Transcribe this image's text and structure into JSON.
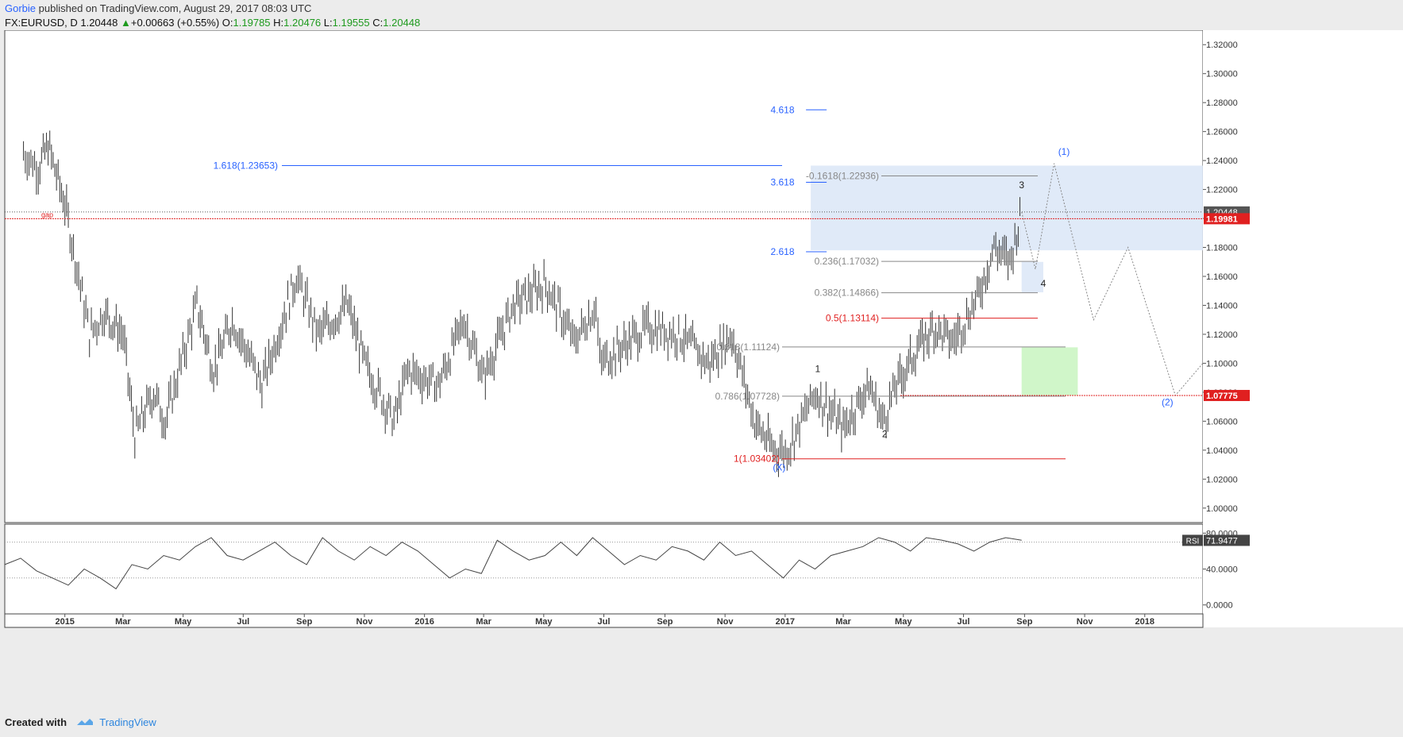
{
  "header": {
    "author": "Gorbie",
    "published": "published on TradingView.com, August 29, 2017 08:03 UTC",
    "symbol": "FX:EURUSD, D",
    "last": "1.20448",
    "change": "+0.00663 (+0.55%)",
    "o_label": "O:",
    "o": "1.19785",
    "h_label": "H:",
    "h": "1.20476",
    "l_label": "L:",
    "l": "1.19555",
    "c_label": "C:",
    "c": "1.20448"
  },
  "footer": {
    "created": "Created with",
    "brand": "TradingView"
  },
  "chart_data": {
    "type": "line",
    "title": "FX:EURUSD, D",
    "x_ticks": [
      "2015",
      "Mar",
      "May",
      "Jul",
      "Sep",
      "Nov",
      "2016",
      "Mar",
      "May",
      "Jul",
      "Sep",
      "Nov",
      "2017",
      "Mar",
      "May",
      "Jul",
      "Sep",
      "Nov",
      "2018"
    ],
    "x_range": [
      "2014-11",
      "2018-03"
    ],
    "price_ticks": [
      "1.32000",
      "1.30000",
      "1.28000",
      "1.26000",
      "1.24000",
      "1.22000",
      "1.20000",
      "1.18000",
      "1.16000",
      "1.14000",
      "1.12000",
      "1.10000",
      "1.08000",
      "1.06000",
      "1.04000",
      "1.02000",
      "1.00000"
    ],
    "ylim": [
      0.99,
      1.33
    ],
    "price_path": [
      {
        "t": "2014-11-20",
        "v": 1.245
      },
      {
        "t": "2014-12-05",
        "v": 1.235
      },
      {
        "t": "2014-12-15",
        "v": 1.25
      },
      {
        "t": "2015-01-01",
        "v": 1.21
      },
      {
        "t": "2015-01-15",
        "v": 1.16
      },
      {
        "t": "2015-01-26",
        "v": 1.12
      },
      {
        "t": "2015-02-10",
        "v": 1.135
      },
      {
        "t": "2015-03-01",
        "v": 1.12
      },
      {
        "t": "2015-03-13",
        "v": 1.05
      },
      {
        "t": "2015-04-01",
        "v": 1.08
      },
      {
        "t": "2015-04-13",
        "v": 1.06
      },
      {
        "t": "2015-05-15",
        "v": 1.14
      },
      {
        "t": "2015-06-01",
        "v": 1.095
      },
      {
        "t": "2015-06-20",
        "v": 1.13
      },
      {
        "t": "2015-07-20",
        "v": 1.085
      },
      {
        "t": "2015-08-24",
        "v": 1.16
      },
      {
        "t": "2015-09-15",
        "v": 1.12
      },
      {
        "t": "2015-10-15",
        "v": 1.14
      },
      {
        "t": "2015-11-01",
        "v": 1.1
      },
      {
        "t": "2015-12-01",
        "v": 1.06
      },
      {
        "t": "2015-12-15",
        "v": 1.095
      },
      {
        "t": "2016-01-15",
        "v": 1.085
      },
      {
        "t": "2016-02-10",
        "v": 1.13
      },
      {
        "t": "2016-03-01",
        "v": 1.09
      },
      {
        "t": "2016-03-31",
        "v": 1.14
      },
      {
        "t": "2016-05-03",
        "v": 1.155
      },
      {
        "t": "2016-06-01",
        "v": 1.115
      },
      {
        "t": "2016-06-23",
        "v": 1.14
      },
      {
        "t": "2016-06-27",
        "v": 1.1
      },
      {
        "t": "2016-08-15",
        "v": 1.125
      },
      {
        "t": "2016-09-15",
        "v": 1.12
      },
      {
        "t": "2016-10-15",
        "v": 1.1
      },
      {
        "t": "2016-11-08",
        "v": 1.12
      },
      {
        "t": "2016-12-01",
        "v": 1.06
      },
      {
        "t": "2016-12-20",
        "v": 1.04
      },
      {
        "t": "2017-01-03",
        "v": 1.04
      },
      {
        "t": "2017-02-01",
        "v": 1.08
      },
      {
        "t": "2017-03-01",
        "v": 1.055
      },
      {
        "t": "2017-03-27",
        "v": 1.085
      },
      {
        "t": "2017-04-10",
        "v": 1.06
      },
      {
        "t": "2017-04-24",
        "v": 1.085
      },
      {
        "t": "2017-05-15",
        "v": 1.11
      },
      {
        "t": "2017-06-01",
        "v": 1.125
      },
      {
        "t": "2017-06-20",
        "v": 1.115
      },
      {
        "t": "2017-07-15",
        "v": 1.145
      },
      {
        "t": "2017-08-01",
        "v": 1.18
      },
      {
        "t": "2017-08-17",
        "v": 1.17
      },
      {
        "t": "2017-08-29",
        "v": 1.2045
      }
    ],
    "projection": [
      {
        "t": "2017-08-29",
        "v": 1.2045
      },
      {
        "t": "2017-09-12",
        "v": 1.165
      },
      {
        "t": "2017-10-01",
        "v": 1.238
      },
      {
        "t": "2017-11-10",
        "v": 1.13
      },
      {
        "t": "2017-12-15",
        "v": 1.18
      },
      {
        "t": "2018-02-01",
        "v": 1.0778
      },
      {
        "t": "2018-03-01",
        "v": 1.1
      }
    ],
    "last_price": {
      "value": "1.20448",
      "color": "#555555"
    },
    "gap_line": {
      "value": "1.19981",
      "label": "gap",
      "color": "#e02020"
    },
    "support_line": {
      "value": "1.07775",
      "color": "#e02020"
    },
    "fib_levels": [
      {
        "label": "4.618",
        "price": 1.275,
        "color": "#2962ff"
      },
      {
        "label": "3.618",
        "price": 1.225,
        "color": "#2962ff"
      },
      {
        "label": "2.618",
        "price": 1.177,
        "color": "#2962ff"
      },
      {
        "label": "1.618(1.23653)",
        "price": 1.23653,
        "color": "#2962ff"
      },
      {
        "label": "-0.1618(1.22936)",
        "price": 1.22936,
        "color": "#888888"
      },
      {
        "label": "0.236(1.17032)",
        "price": 1.17032,
        "color": "#888888"
      },
      {
        "label": "0.382(1.14866)",
        "price": 1.14866,
        "color": "#888888"
      },
      {
        "label": "0.5(1.13114)",
        "price": 1.13114,
        "color": "#e02020"
      },
      {
        "label": "0.618(1.11124)",
        "price": 1.11124,
        "color": "#888888"
      },
      {
        "label": "0.786(1.07728)",
        "price": 1.07728,
        "color": "#888888"
      },
      {
        "label": "1(1.03402)",
        "price": 1.03402,
        "color": "#e02020"
      }
    ],
    "wave_labels": [
      {
        "label": "1",
        "color": "#222222"
      },
      {
        "label": "2",
        "color": "#222222"
      },
      {
        "label": "3",
        "color": "#222222"
      },
      {
        "label": "4",
        "color": "#222222"
      },
      {
        "label": "(X)",
        "color": "#2962ff"
      },
      {
        "label": "(1)",
        "color": "#2962ff"
      },
      {
        "label": "(2)",
        "color": "#2962ff"
      }
    ],
    "zones": [
      {
        "name": "target-zone",
        "price_range": [
          1.178,
          1.2365
        ],
        "color": "#dbe6f7"
      },
      {
        "name": "wave4-zone",
        "price_range": [
          1.149,
          1.17
        ],
        "color": "#dbe6f7"
      },
      {
        "name": "support-zone",
        "price_range": [
          1.078,
          1.111
        ],
        "color": "#c8f5c0"
      }
    ],
    "rsi": {
      "label": "RSI",
      "value": "71.9477",
      "ticks": [
        "80.0000",
        "40.0000",
        "0.0000"
      ],
      "ylim": [
        -10,
        90
      ],
      "levels": [
        70,
        30
      ],
      "values": [
        45,
        52,
        38,
        30,
        22,
        40,
        30,
        18,
        45,
        40,
        55,
        50,
        65,
        75,
        55,
        50,
        60,
        70,
        55,
        45,
        75,
        60,
        50,
        65,
        55,
        70,
        60,
        45,
        30,
        40,
        35,
        72,
        60,
        50,
        55,
        70,
        55,
        75,
        60,
        45,
        55,
        50,
        65,
        60,
        50,
        70,
        55,
        60,
        45,
        30,
        50,
        40,
        55,
        60,
        65,
        75,
        70,
        60,
        75,
        72,
        68,
        60,
        70,
        75,
        72
      ]
    }
  }
}
